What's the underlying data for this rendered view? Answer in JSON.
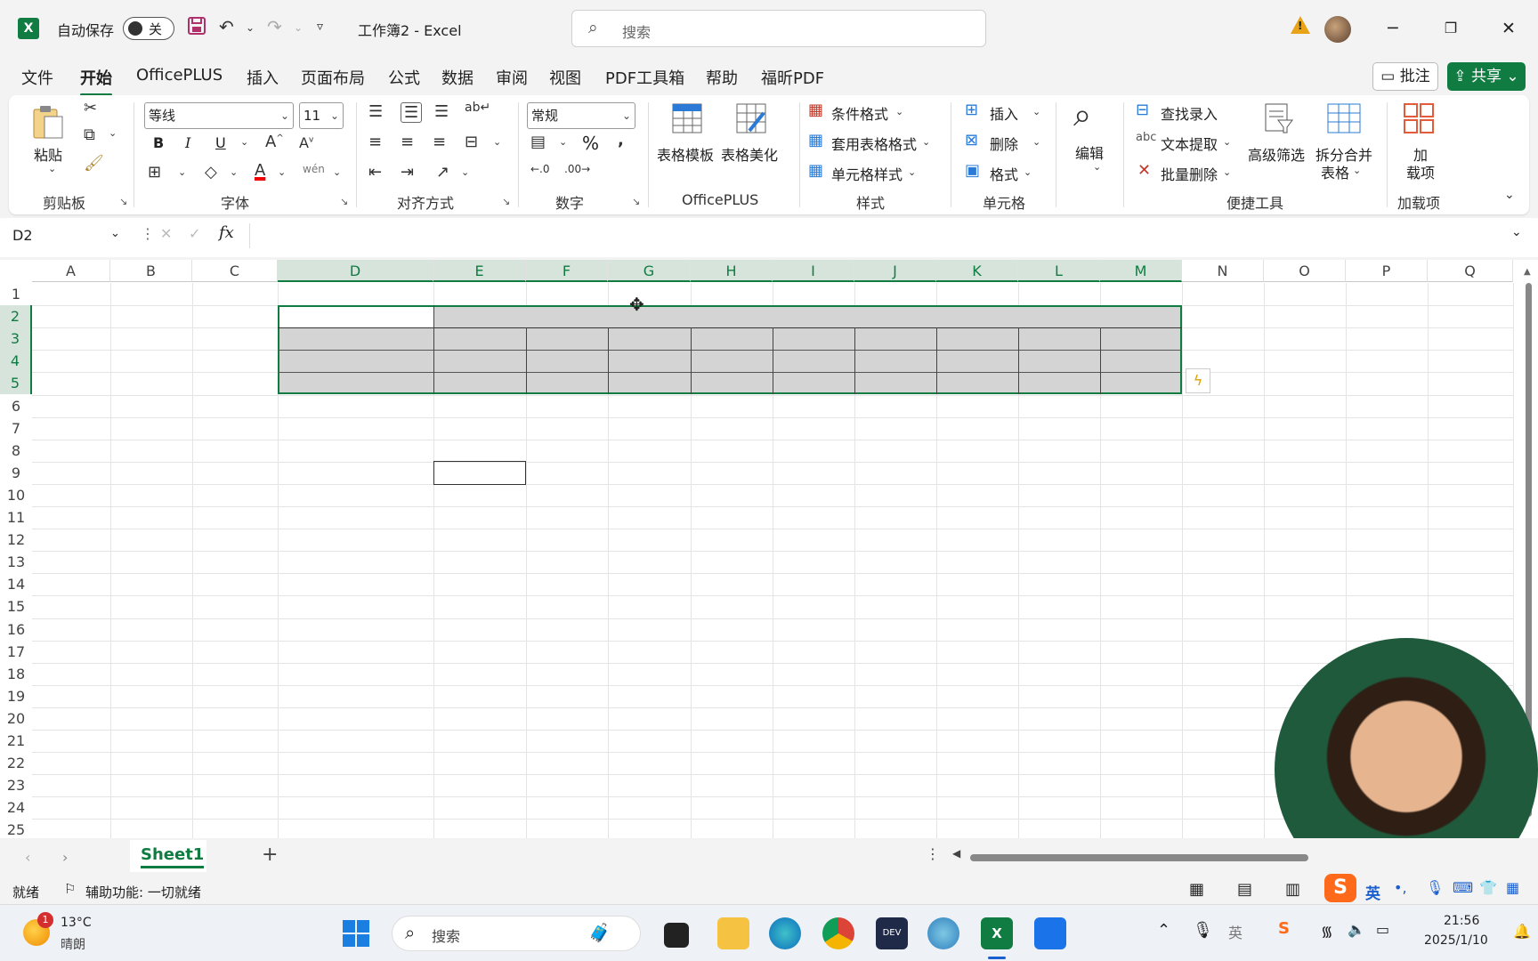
{
  "titlebar": {
    "autosave_label": "自动保存",
    "autosave_state": "关",
    "doc_title": "工作簿2  -  Excel",
    "search_placeholder": "搜索",
    "minimize": "─",
    "restore": "❐",
    "close": "✕"
  },
  "menu": {
    "tabs": [
      "文件",
      "开始",
      "OfficePLUS",
      "插入",
      "页面布局",
      "公式",
      "数据",
      "审阅",
      "视图",
      "PDF工具箱",
      "帮助",
      "福昕PDF"
    ],
    "active": "开始",
    "comment": "批注",
    "share": "共享"
  },
  "ribbon": {
    "clipboard": {
      "paste": "粘贴",
      "label": "剪贴板"
    },
    "font": {
      "name": "等线",
      "size": "11",
      "bold": "B",
      "italic": "I",
      "underline": "U",
      "label": "字体"
    },
    "align": {
      "label": "对齐方式"
    },
    "number": {
      "format": "常规",
      "percent": "%",
      "label": "数字"
    },
    "officeplus": {
      "template": "表格模板",
      "beautify": "表格美化",
      "label": "OfficePLUS"
    },
    "styles": {
      "conditional": "条件格式",
      "table_format": "套用表格格式",
      "cell_style": "单元格样式",
      "label": "样式"
    },
    "cells": {
      "insert": "插入",
      "delete": "删除",
      "format": "格式",
      "label": "单元格"
    },
    "editing": {
      "edit": "编辑"
    },
    "quick": {
      "lookup": "查找录入",
      "extract": "文本提取",
      "batch_delete": "批量删除",
      "advanced_filter": "高级筛选",
      "split_merge_1": "拆分合并",
      "split_merge_2": "表格",
      "label": "便捷工具"
    },
    "addins": {
      "add_1": "加",
      "add_2": "载项",
      "label": "加载项"
    }
  },
  "formula": {
    "namebox": "D2",
    "fx": "fx"
  },
  "grid": {
    "columns": [
      "A",
      "B",
      "C",
      "D",
      "E",
      "F",
      "G",
      "H",
      "I",
      "J",
      "K",
      "L",
      "M",
      "N",
      "O",
      "P",
      "Q"
    ],
    "rows": [
      "1",
      "2",
      "3",
      "4",
      "5",
      "6",
      "7",
      "8",
      "9",
      "10",
      "11",
      "12",
      "13",
      "14",
      "15",
      "16",
      "17",
      "18",
      "19",
      "20",
      "21",
      "22",
      "23",
      "24",
      "25"
    ],
    "selected_range": "D2:M5"
  },
  "sheets": {
    "tabs": [
      "Sheet1"
    ],
    "add": "+"
  },
  "status": {
    "ready": "就绪",
    "accessibility": "辅助功能: 一切就绪"
  },
  "ime": {
    "lang": "英"
  },
  "taskbar": {
    "weather_temp": "13°C",
    "weather_desc": "晴朗",
    "weather_badge": "1",
    "search": "搜索",
    "time": "21:56",
    "date": "2025/1/10"
  }
}
